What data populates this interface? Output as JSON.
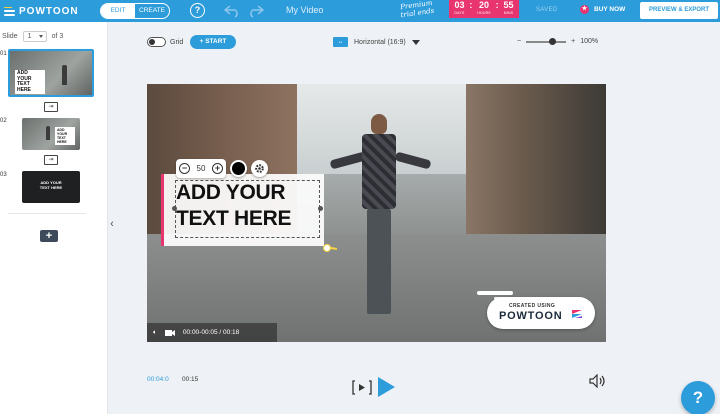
{
  "header": {
    "logo_text": "POWTOON",
    "mode_edit": "EDIT",
    "mode_create": "CREATE",
    "help": "?",
    "doc_title": "My Video",
    "trial_label_line1": "Premium",
    "trial_label_line2": "trial ends",
    "timer": [
      {
        "value": "03",
        "unit": "DAYS"
      },
      {
        "value": "20",
        "unit": "HOURS"
      },
      {
        "value": "55",
        "unit": "MINS"
      }
    ],
    "saved": "SAVED",
    "buy_now": "BUY NOW",
    "preview_export": "PREVIEW & EXPORT",
    "accent_color": "#2d9cdb",
    "timer_color": "#e8346f"
  },
  "sidebar": {
    "slide_label": "Slide",
    "slide_current": "1",
    "slide_total": "of 3",
    "slides": [
      {
        "number": "01",
        "title": "ADD YOUR TEXT HERE"
      },
      {
        "number": "02",
        "title": "ADD YOUR TEXT HERE"
      },
      {
        "number": "03",
        "title": "ADD YOUR TEXT HERE"
      }
    ],
    "add_slide": "+",
    "collapse": "‹"
  },
  "toolbar": {
    "grid_label": "Grid",
    "start_label": "+ START",
    "ratio_label": "Horizontal (16:9)",
    "zoom_value": "100%",
    "zoom_fraction": 0.65
  },
  "canvas": {
    "text_box": "ADD YOUR TEXT HERE",
    "font_size": "50",
    "minus": "−",
    "plus": "+",
    "watermark_top": "CREATED USING",
    "watermark_logo": "POWTOON",
    "video_time": "00:00-00:05 / 00:18"
  },
  "timeline": {
    "current_time": "00:04:0",
    "total_time": "00:15"
  },
  "help_fab": "?"
}
